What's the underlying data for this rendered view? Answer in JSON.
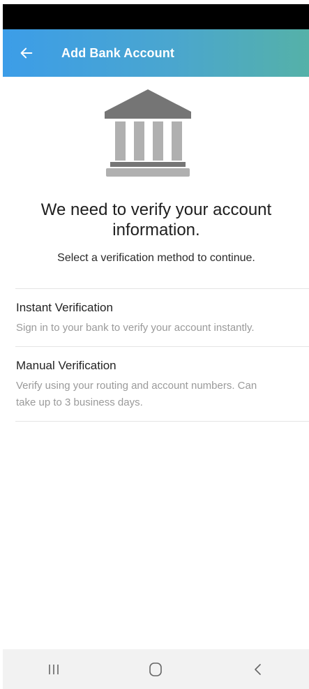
{
  "app_bar": {
    "title": "Add Bank Account",
    "back_icon": "arrow-left-icon",
    "gradient_colors": [
      "#3c9de8",
      "#55b1a8"
    ]
  },
  "hero": {
    "icon": "bank-icon",
    "headline": "We need to verify your account information.",
    "subline": "Select a verification method to continue."
  },
  "options": [
    {
      "title": "Instant Verification",
      "description": "Sign in to your bank to verify your account instantly."
    },
    {
      "title": "Manual Verification",
      "description": "Verify using your routing and account numbers. Can take up to 3 business days."
    }
  ],
  "system_nav": {
    "recents_icon": "recents-icon",
    "home_icon": "home-icon",
    "back_icon": "back-chevron-icon"
  }
}
